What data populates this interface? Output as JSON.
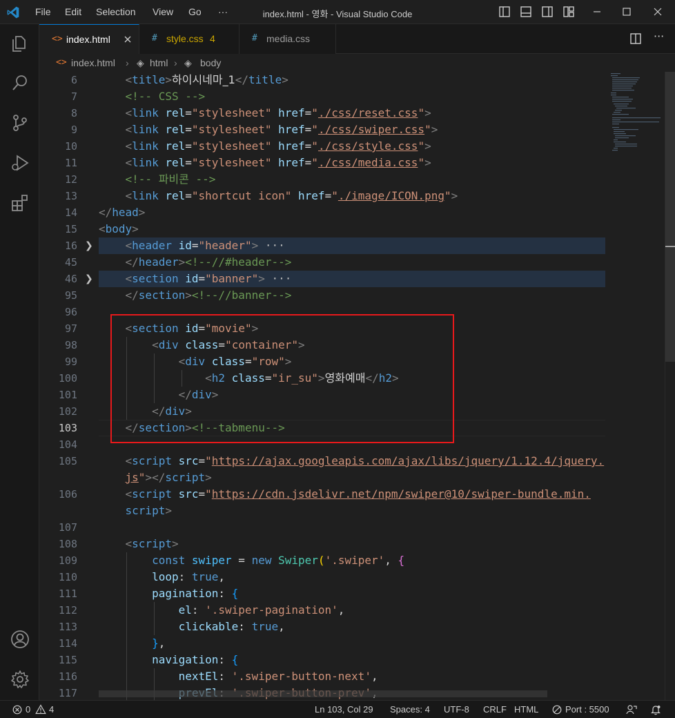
{
  "window": {
    "title": "index.html - 영화 - Visual Studio Code"
  },
  "menu": [
    "File",
    "Edit",
    "Selection",
    "View",
    "Go",
    "···"
  ],
  "tabs": [
    {
      "label": "index.html",
      "icon": "<>"
    },
    {
      "label": "style.css",
      "icon": "#",
      "badge": "4"
    },
    {
      "label": "media.css",
      "icon": "#"
    }
  ],
  "breadcrumb": {
    "file": "index.html",
    "items": [
      "html",
      "body"
    ]
  },
  "editor": {
    "line_numbers": [
      "6",
      "7",
      "8",
      "9",
      "10",
      "11",
      "12",
      "13",
      "14",
      "15",
      "16",
      "45",
      "46",
      "95",
      "96",
      "97",
      "98",
      "99",
      "100",
      "101",
      "102",
      "103",
      "104",
      "105",
      "",
      "106",
      "",
      "107",
      "108",
      "109",
      "110",
      "111",
      "112",
      "113",
      "114",
      "115",
      "116",
      "117"
    ],
    "active_line": "103",
    "folded_lines": [
      "16",
      "46"
    ],
    "fold_ellipsis": "···",
    "code": {
      "title_text": "하이시네마_1",
      "comment_css": "<!-- CSS -->",
      "rel_attr": "rel",
      "href_attr": "href",
      "stylesheet": "\"stylesheet\"",
      "css_reset": "./css/reset.css",
      "css_swiper": "./css/swiper.css",
      "css_style": "./css/style.css",
      "css_media": "./css/media.css",
      "comment_favicon": "<!-- 파비콘 -->",
      "shortcut_icon": "\"shortcut icon\"",
      "icon_href": "./image/ICON.png",
      "id_header": "\"header\"",
      "comment_header": "<!--//#header-->",
      "id_banner": "\"banner\"",
      "comment_banner": "<!--//banner-->",
      "id_movie": "\"movie\"",
      "class_container": "\"container\"",
      "class_row": "\"row\"",
      "class_irsu": "\"ir_su\"",
      "h2_text": "영화예매",
      "comment_tabmenu": "<!--tabmenu-->",
      "src_jquery": "https://ajax.googleapis.com/ajax/libs/jquery/1.12.4/jquery.",
      "src_jquery_cont": "js",
      "src_swiper": "https://cdn.jsdelivr.net/npm/swiper@10/swiper-bundle.min.",
      "src_swiper_cont": "script",
      "js_const": "const",
      "js_swiper_var": "swiper",
      "js_new": "new",
      "js_swiper_cls": "Swiper",
      "js_selector": "'.swiper'",
      "js_loop": "loop",
      "js_true": "true",
      "js_pagination": "pagination",
      "js_el": "el",
      "js_pag_sel": "'.swiper-pagination'",
      "js_clickable": "clickable",
      "js_navigation": "navigation",
      "js_nextEl": "nextEl",
      "js_next_sel": "'.swiper-button-next'",
      "js_prevEl": "prevEl",
      "js_prev_sel": "'.swiper-button-prev'"
    }
  },
  "statusbar": {
    "errors": "0",
    "warnings": "4",
    "position": "Ln 103, Col 29",
    "spaces": "Spaces: 4",
    "encoding": "UTF-8",
    "eol": "CRLF",
    "language": "HTML",
    "port": "Port : 5500"
  },
  "colors": {
    "accent": "#0078d4",
    "highlight_box": "#e8191b",
    "warning_tab": "#cca700"
  }
}
